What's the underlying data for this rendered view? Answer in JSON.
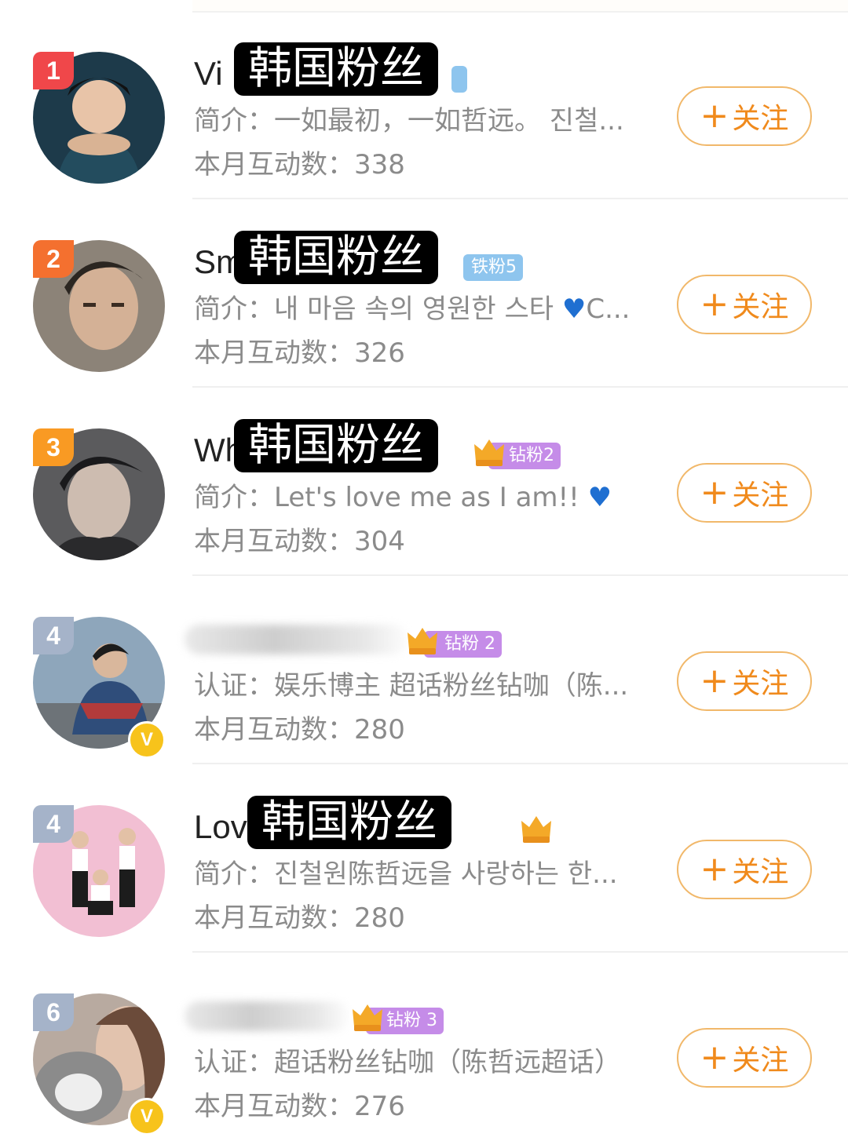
{
  "watermark": "韩国粉丝",
  "follow_label": "关注",
  "follow_plus": "+",
  "count_label": "本月互动数：",
  "rows": [
    {
      "rank": "1",
      "name": "Vi",
      "overlay": "韩国粉丝",
      "badge": "",
      "desc_label": "简介：",
      "desc": "一如最初，一如哲远。 진철...",
      "count": "338"
    },
    {
      "rank": "2",
      "name": "Sm",
      "overlay": "韩国粉丝",
      "badge": "铁粉5",
      "desc_label": "简介：",
      "desc": "내 마음 속의 영원한 스타 ",
      "desc_tail": "C...",
      "count": "326"
    },
    {
      "rank": "3",
      "name": "Wh",
      "overlay": "韩国粉丝",
      "badge": "钻粉2",
      "desc_label": "简介：",
      "desc": "Let's love me as I am!! ",
      "count": "304"
    },
    {
      "rank": "4",
      "name": "",
      "overlay": "",
      "badge": "钻粉 2",
      "desc_label": "认证：",
      "desc": "娱乐博主 超话粉丝钻咖（陈...",
      "count": "280"
    },
    {
      "rank": "4",
      "name": "Lov",
      "overlay": "韩国粉丝",
      "badge": "",
      "desc_label": "简介：",
      "desc": "진철원陈哲远을 사랑하는 한...",
      "count": "280"
    },
    {
      "rank": "6",
      "name": "",
      "overlay": "",
      "badge": "钻粉 3",
      "desc_label": "认证：",
      "desc": "超话粉丝钻咖（陈哲远超话）",
      "count": "276"
    }
  ],
  "heart_icon": "blue-heart-icon"
}
